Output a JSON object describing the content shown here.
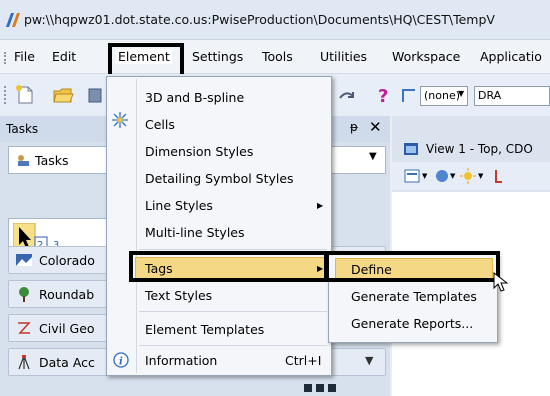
{
  "window": {
    "title": "pw:\\\\hqpwz01.dot.state.co.us:PwiseProduction\\Documents\\HQ\\CEST\\TempV"
  },
  "menubar": {
    "items": [
      {
        "label": "File",
        "underline": "F"
      },
      {
        "label": "Edit",
        "underline": "E"
      },
      {
        "label": "Element",
        "underline": "l"
      },
      {
        "label": "Settings",
        "underline": "S"
      },
      {
        "label": "Tools",
        "underline": "T"
      },
      {
        "label": "Utilities",
        "underline": "U"
      },
      {
        "label": "Workspace",
        "underline": "k"
      },
      {
        "label": "Applicatio",
        "underline": "A"
      }
    ]
  },
  "toolbar": {
    "combo_value": "(none)",
    "combo2_value": "DRA"
  },
  "tasks_panel": {
    "title": "Tasks",
    "pin_glyph": "ᵽ",
    "close_glyph": "✕",
    "dropdown_label": "Tasks",
    "rows": [
      {
        "label": "Colorado",
        "icon": "colorado-icon"
      },
      {
        "label": "Roundab",
        "icon": "roundabout-icon"
      },
      {
        "label": "Civil Geo",
        "icon": "civil-geometry-icon"
      },
      {
        "label": "Data Acc",
        "icon": "data-acquisition-icon"
      }
    ]
  },
  "view": {
    "tab_label": "View 1 - Top, CDO"
  },
  "element_menu": {
    "items": [
      {
        "label": "3D and B-spline",
        "submenu": false
      },
      {
        "label": "Cells",
        "submenu": false,
        "icon": "cells-icon"
      },
      {
        "label": "Dimension Styles",
        "submenu": false
      },
      {
        "label": "Detailing Symbol Styles",
        "submenu": false
      },
      {
        "label": "Line Styles",
        "submenu": true
      },
      {
        "label": "Multi-line Styles",
        "submenu": false
      },
      {
        "label": "Tags",
        "submenu": true,
        "highlighted": true
      },
      {
        "label": "Text Styles",
        "submenu": false
      },
      {
        "label": "Element Templates",
        "submenu": false
      },
      {
        "label": "Information",
        "submenu": false,
        "shortcut": "Ctrl+I",
        "icon": "info-icon"
      }
    ]
  },
  "tags_submenu": {
    "items": [
      {
        "label": "Define",
        "highlighted": true
      },
      {
        "label": "Generate Templates"
      },
      {
        "label": "Generate Reports..."
      }
    ]
  },
  "colors": {
    "hover_fill": "#f5d886",
    "hover_border": "#e0b44c",
    "highlight_box": "#000000"
  }
}
